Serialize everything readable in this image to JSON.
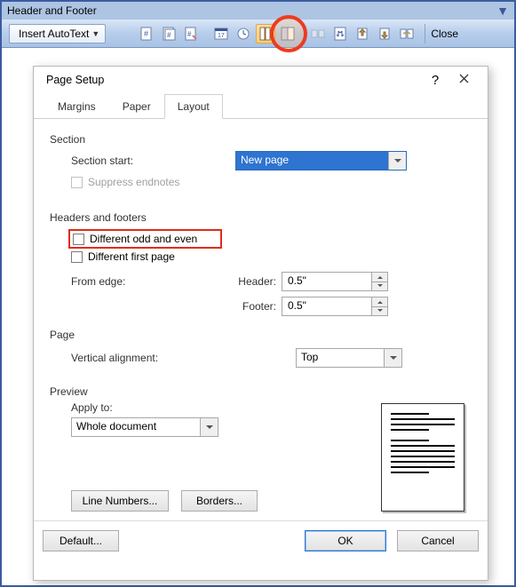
{
  "toolbar": {
    "title": "Header and Footer",
    "autotext_label": "Insert AutoText",
    "close_label": "Close"
  },
  "dialog": {
    "title": "Page Setup",
    "tabs": {
      "margins": "Margins",
      "paper": "Paper",
      "layout": "Layout"
    },
    "section": {
      "group": "Section",
      "start_label": "Section start:",
      "start_value": "New page",
      "suppress_label": "Suppress endnotes"
    },
    "hf": {
      "group": "Headers and footers",
      "odd_even": "Different odd and even",
      "first_page": "Different first page",
      "from_edge": "From edge:",
      "header_label": "Header:",
      "header_value": "0.5\"",
      "footer_label": "Footer:",
      "footer_value": "0.5\""
    },
    "page": {
      "group": "Page",
      "valign_label": "Vertical alignment:",
      "valign_value": "Top"
    },
    "preview": {
      "group": "Preview",
      "apply_label": "Apply to:",
      "apply_value": "Whole document"
    },
    "buttons": {
      "line_numbers": "Line Numbers...",
      "borders": "Borders...",
      "default": "Default...",
      "ok": "OK",
      "cancel": "Cancel"
    }
  }
}
